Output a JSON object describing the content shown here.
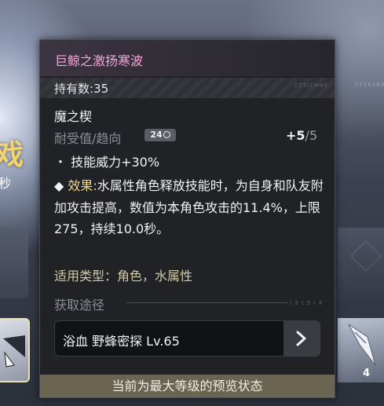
{
  "background": {
    "char_title": "戏",
    "char_sub": "秒",
    "card_count": "4",
    "side_text_a": "CF1K1K0",
    "side_text_b": "C I 8 J I 9"
  },
  "panel": {
    "title": "巨鲸之激扬寒波",
    "owned": "持有数:35",
    "owned_faint": "CTTICHHT",
    "category": "魔之楔",
    "durability_label": "耐受值/趋向",
    "durability_badge": "24",
    "level_current": "+5",
    "level_sep": "/",
    "level_max": "5",
    "stat_line": "・ 技能威力+30%",
    "effect_bullet": "◆ ",
    "effect_prefix": "效果:",
    "effect_text": "水属性角色释放技能时，为自身和队友附加攻击提高，数值为本角色攻击的11.4%，上限275，持续10.0秒。",
    "applicable": "适用类型：角色，水属性",
    "acquire_head": "获取途径",
    "acquire_faint": "I  Ǝ Ɩ 9 Ɩ 8",
    "source_label": "浴血 野蜂密探 Lv.65",
    "footer": "当前为最大等级的预览状态"
  },
  "colors": {
    "title": "#f3a6d8",
    "effect_prefix": "#f2d78b",
    "applicable": "#d3c9a9",
    "footer_bg": "#6b6451"
  }
}
